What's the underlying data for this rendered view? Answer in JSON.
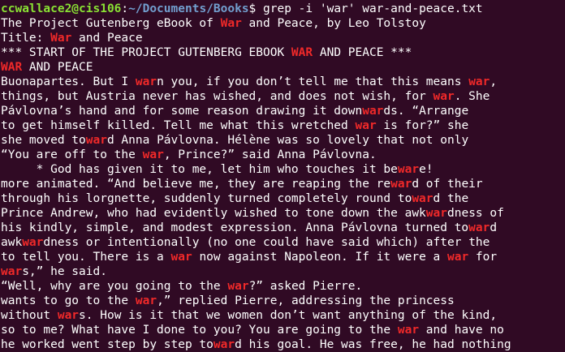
{
  "colors": {
    "background": "#300a24",
    "text": "#ffffff",
    "prompt_user": "#8ae234",
    "prompt_path": "#729fcf",
    "match": "#ef2929"
  },
  "prompt": {
    "user_host": "ccwallace2@cis106",
    "separator": ":",
    "path": "~/Documents/Books",
    "symbol": "$ ",
    "command": "grep -i 'war' war-and-peace.txt"
  },
  "output_lines": [
    [
      [
        "t",
        "The Project Gutenberg eBook of "
      ],
      [
        "m",
        "War"
      ],
      [
        "t",
        " and Peace, by Leo Tolstoy"
      ]
    ],
    [
      [
        "t",
        "Title: "
      ],
      [
        "m",
        "War"
      ],
      [
        "t",
        " and Peace"
      ]
    ],
    [
      [
        "t",
        "*** START OF THE PROJECT GUTENBERG EBOOK "
      ],
      [
        "m",
        "WAR"
      ],
      [
        "t",
        " AND PEACE ***"
      ]
    ],
    [
      [
        "m",
        "WAR"
      ],
      [
        "t",
        " AND PEACE"
      ]
    ],
    [
      [
        "t",
        "Buonapartes. But I "
      ],
      [
        "m",
        "war"
      ],
      [
        "t",
        "n you, if you don’t tell me that this means "
      ],
      [
        "m",
        "war"
      ],
      [
        "t",
        ","
      ]
    ],
    [
      [
        "t",
        "things, but Austria never has wished, and does not wish, for "
      ],
      [
        "m",
        "war"
      ],
      [
        "t",
        ". She"
      ]
    ],
    [
      [
        "t",
        "Pávlovna’s hand and for some reason drawing it down"
      ],
      [
        "m",
        "war"
      ],
      [
        "t",
        "ds. “Arrange"
      ]
    ],
    [
      [
        "t",
        "to get himself killed. Tell me what this wretched "
      ],
      [
        "m",
        "war"
      ],
      [
        "t",
        " is for?” she"
      ]
    ],
    [
      [
        "t",
        "she moved to"
      ],
      [
        "m",
        "war"
      ],
      [
        "t",
        "d Anna Pávlovna. Hélène was so lovely that not only"
      ]
    ],
    [
      [
        "t",
        "“You are off to the "
      ],
      [
        "m",
        "war"
      ],
      [
        "t",
        ", Prince?” said Anna Pávlovna."
      ]
    ],
    [
      [
        "t",
        "     * God has given it to me, let him who touches it be"
      ],
      [
        "m",
        "war"
      ],
      [
        "t",
        "e!"
      ]
    ],
    [
      [
        "t",
        "more animated. “And believe me, they are reaping the re"
      ],
      [
        "m",
        "war"
      ],
      [
        "t",
        "d of their"
      ]
    ],
    [
      [
        "t",
        "through his lorgnette, suddenly turned completely round to"
      ],
      [
        "m",
        "war"
      ],
      [
        "t",
        "d the"
      ]
    ],
    [
      [
        "t",
        "Prince Andrew, who had evidently wished to tone down the awk"
      ],
      [
        "m",
        "war"
      ],
      [
        "t",
        "dness of"
      ]
    ],
    [
      [
        "t",
        "his kindly, simple, and modest expression. Anna Pávlovna turned to"
      ],
      [
        "m",
        "war"
      ],
      [
        "t",
        "d"
      ]
    ],
    [
      [
        "t",
        "awk"
      ],
      [
        "m",
        "war"
      ],
      [
        "t",
        "dness or intentionally (no one could have said which) after the"
      ]
    ],
    [
      [
        "t",
        "to tell you. There is a "
      ],
      [
        "m",
        "war"
      ],
      [
        "t",
        " now against Napoleon. If it were a "
      ],
      [
        "m",
        "war"
      ],
      [
        "t",
        " for"
      ]
    ],
    [
      [
        "m",
        "war"
      ],
      [
        "t",
        "s,” he said."
      ]
    ],
    [
      [
        "t",
        "“Well, why are you going to the "
      ],
      [
        "m",
        "war"
      ],
      [
        "t",
        "?” asked Pierre."
      ]
    ],
    [
      [
        "t",
        "wants to go to the "
      ],
      [
        "m",
        "war"
      ],
      [
        "t",
        ",” replied Pierre, addressing the princess"
      ]
    ],
    [
      [
        "t",
        "without "
      ],
      [
        "m",
        "war"
      ],
      [
        "t",
        "s. How is it that we women don’t want anything of the kind,"
      ]
    ],
    [
      [
        "t",
        "so to me? What have I done to you? You are going to the "
      ],
      [
        "m",
        "war"
      ],
      [
        "t",
        " and have no"
      ]
    ],
    [
      [
        "t",
        "he worked went step by step to"
      ],
      [
        "m",
        "war"
      ],
      [
        "t",
        "d his goal. He was free, he had nothing"
      ]
    ]
  ]
}
